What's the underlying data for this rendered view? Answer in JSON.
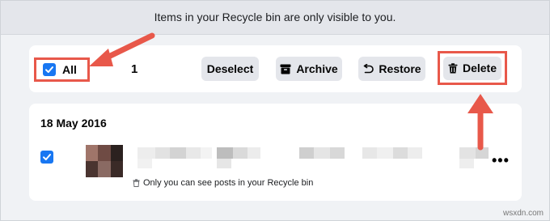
{
  "banner": {
    "text": "Items in your Recycle bin are only visible to you."
  },
  "toolbar": {
    "all_label": "All",
    "selected_count": "1",
    "deselect_label": "Deselect",
    "archive_label": "Archive",
    "restore_label": "Restore",
    "delete_label": "Delete"
  },
  "post": {
    "date": "18 May 2016",
    "note": "Only you can see posts in your Recycle bin",
    "more_label": "•••"
  },
  "icons": {
    "checkbox": "checkmark-icon",
    "archive": "archive-box-icon",
    "restore": "undo-arrow-icon",
    "delete": "trash-icon",
    "note": "trash-icon"
  },
  "colors": {
    "accent": "#1877f2",
    "annotation": "#e8584a",
    "button_bg": "#e4e6eb"
  },
  "watermark": "wsxdn.com"
}
